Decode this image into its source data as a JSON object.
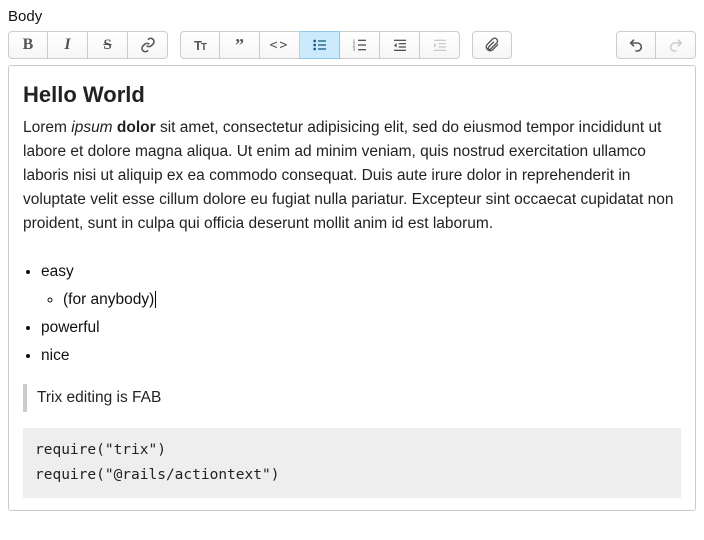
{
  "label": "Body",
  "toolbar": {
    "text_tools": [
      "bold",
      "italic",
      "strikethrough",
      "link"
    ],
    "block_tools": [
      "heading",
      "quote",
      "code",
      "bullet-list",
      "number-list",
      "outdent",
      "indent"
    ],
    "active": "bullet-list",
    "disabled": [
      "indent",
      "redo"
    ],
    "attach": "attach",
    "history": [
      "undo",
      "redo"
    ]
  },
  "content": {
    "heading": "Hello World",
    "para_prefix": "Lorem ",
    "para_em": "ipsum",
    "para_mid": " ",
    "para_bold": "dolor",
    "para_rest": " sit amet, consectetur adipisicing elit, sed do eiusmod tempor incididunt ut labore et dolore magna aliqua. Ut enim ad minim veniam, quis nostrud exercitation ullamco laboris nisi ut aliquip ex ea commodo consequat. Duis aute irure dolor in reprehenderit in voluptate velit esse cillum dolore eu fugiat nulla pariatur. Excepteur sint occaecat cupidatat non proident, sunt in culpa qui officia deserunt mollit anim id est laborum.",
    "list": {
      "0": "easy",
      "0_sub": "(for anybody)",
      "1": "powerful",
      "2": "nice"
    },
    "blockquote": "Trix editing is FAB",
    "code_line_0": "require(\"trix\")",
    "code_line_1": "require(\"@rails/actiontext\")"
  }
}
